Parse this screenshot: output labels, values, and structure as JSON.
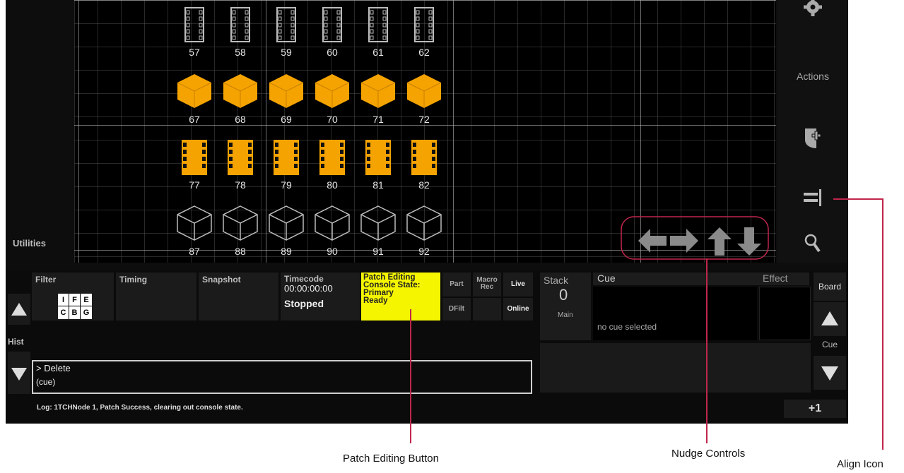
{
  "fixtures": {
    "row1": [
      "57",
      "58",
      "59",
      "60",
      "61",
      "62"
    ],
    "row2": [
      "67",
      "68",
      "69",
      "70",
      "71",
      "72"
    ],
    "row3": [
      "77",
      "78",
      "79",
      "80",
      "81",
      "82"
    ],
    "row4": [
      "87",
      "88",
      "89",
      "90",
      "91",
      "92"
    ]
  },
  "sidebar_left": {
    "utilities": "Utilities"
  },
  "sidebar_right": {
    "actions": "Actions"
  },
  "bottom": {
    "filter": "Filter",
    "filter_keys": [
      "I",
      "F",
      "E",
      "C",
      "B",
      "G"
    ],
    "timing": "Timing",
    "snapshot": "Snapshot",
    "timecode_label": "Timecode",
    "timecode_value": "00:00:00:00",
    "timecode_status": "Stopped",
    "patch_line1": "Patch Editing",
    "patch_line2": "Console State:",
    "patch_line3": "Primary",
    "patch_line4": "Ready",
    "part": "Part",
    "macro_rec": "Macro Rec",
    "live": "Live",
    "dfilt": "DFilt",
    "online": "Online",
    "hist": "Hist",
    "cmd_line1": "> Delete",
    "cmd_line2": "(cue)",
    "log": "Log: 1TCHNode 1, Patch Success, clearing out console state.",
    "stack_label": "Stack",
    "stack_value": "0",
    "stack_main": "Main",
    "cue_label": "Cue",
    "cue_status": "no cue selected",
    "effect_label": "Effect",
    "board": "Board",
    "cue_small": "Cue",
    "plus_one": "+1"
  },
  "callouts": {
    "patch": "Patch Editing Button",
    "nudge": "Nudge Controls",
    "align": "Align Icon"
  },
  "colors": {
    "accent": "#f5a300",
    "patch_bg": "#f5f500",
    "callout": "#c0264c"
  }
}
